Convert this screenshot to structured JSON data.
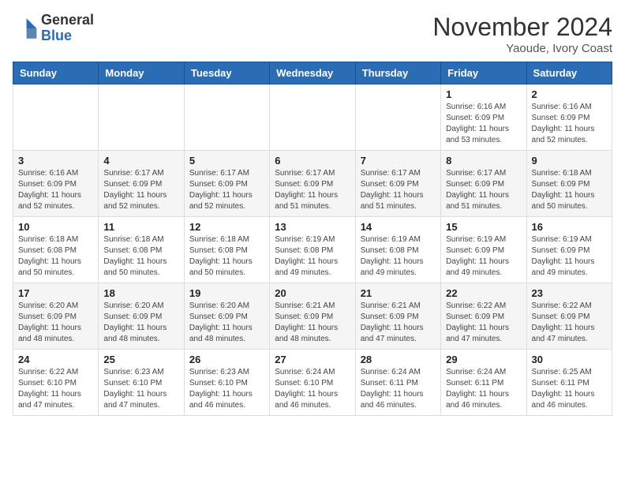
{
  "logo": {
    "general": "General",
    "blue": "Blue"
  },
  "title": "November 2024",
  "location": "Yaoude, Ivory Coast",
  "days_of_week": [
    "Sunday",
    "Monday",
    "Tuesday",
    "Wednesday",
    "Thursday",
    "Friday",
    "Saturday"
  ],
  "weeks": [
    [
      {
        "day": "",
        "detail": ""
      },
      {
        "day": "",
        "detail": ""
      },
      {
        "day": "",
        "detail": ""
      },
      {
        "day": "",
        "detail": ""
      },
      {
        "day": "",
        "detail": ""
      },
      {
        "day": "1",
        "detail": "Sunrise: 6:16 AM\nSunset: 6:09 PM\nDaylight: 11 hours and 53 minutes."
      },
      {
        "day": "2",
        "detail": "Sunrise: 6:16 AM\nSunset: 6:09 PM\nDaylight: 11 hours and 52 minutes."
      }
    ],
    [
      {
        "day": "3",
        "detail": "Sunrise: 6:16 AM\nSunset: 6:09 PM\nDaylight: 11 hours and 52 minutes."
      },
      {
        "day": "4",
        "detail": "Sunrise: 6:17 AM\nSunset: 6:09 PM\nDaylight: 11 hours and 52 minutes."
      },
      {
        "day": "5",
        "detail": "Sunrise: 6:17 AM\nSunset: 6:09 PM\nDaylight: 11 hours and 52 minutes."
      },
      {
        "day": "6",
        "detail": "Sunrise: 6:17 AM\nSunset: 6:09 PM\nDaylight: 11 hours and 51 minutes."
      },
      {
        "day": "7",
        "detail": "Sunrise: 6:17 AM\nSunset: 6:09 PM\nDaylight: 11 hours and 51 minutes."
      },
      {
        "day": "8",
        "detail": "Sunrise: 6:17 AM\nSunset: 6:09 PM\nDaylight: 11 hours and 51 minutes."
      },
      {
        "day": "9",
        "detail": "Sunrise: 6:18 AM\nSunset: 6:09 PM\nDaylight: 11 hours and 50 minutes."
      }
    ],
    [
      {
        "day": "10",
        "detail": "Sunrise: 6:18 AM\nSunset: 6:08 PM\nDaylight: 11 hours and 50 minutes."
      },
      {
        "day": "11",
        "detail": "Sunrise: 6:18 AM\nSunset: 6:08 PM\nDaylight: 11 hours and 50 minutes."
      },
      {
        "day": "12",
        "detail": "Sunrise: 6:18 AM\nSunset: 6:08 PM\nDaylight: 11 hours and 50 minutes."
      },
      {
        "day": "13",
        "detail": "Sunrise: 6:19 AM\nSunset: 6:08 PM\nDaylight: 11 hours and 49 minutes."
      },
      {
        "day": "14",
        "detail": "Sunrise: 6:19 AM\nSunset: 6:08 PM\nDaylight: 11 hours and 49 minutes."
      },
      {
        "day": "15",
        "detail": "Sunrise: 6:19 AM\nSunset: 6:09 PM\nDaylight: 11 hours and 49 minutes."
      },
      {
        "day": "16",
        "detail": "Sunrise: 6:19 AM\nSunset: 6:09 PM\nDaylight: 11 hours and 49 minutes."
      }
    ],
    [
      {
        "day": "17",
        "detail": "Sunrise: 6:20 AM\nSunset: 6:09 PM\nDaylight: 11 hours and 48 minutes."
      },
      {
        "day": "18",
        "detail": "Sunrise: 6:20 AM\nSunset: 6:09 PM\nDaylight: 11 hours and 48 minutes."
      },
      {
        "day": "19",
        "detail": "Sunrise: 6:20 AM\nSunset: 6:09 PM\nDaylight: 11 hours and 48 minutes."
      },
      {
        "day": "20",
        "detail": "Sunrise: 6:21 AM\nSunset: 6:09 PM\nDaylight: 11 hours and 48 minutes."
      },
      {
        "day": "21",
        "detail": "Sunrise: 6:21 AM\nSunset: 6:09 PM\nDaylight: 11 hours and 47 minutes."
      },
      {
        "day": "22",
        "detail": "Sunrise: 6:22 AM\nSunset: 6:09 PM\nDaylight: 11 hours and 47 minutes."
      },
      {
        "day": "23",
        "detail": "Sunrise: 6:22 AM\nSunset: 6:09 PM\nDaylight: 11 hours and 47 minutes."
      }
    ],
    [
      {
        "day": "24",
        "detail": "Sunrise: 6:22 AM\nSunset: 6:10 PM\nDaylight: 11 hours and 47 minutes."
      },
      {
        "day": "25",
        "detail": "Sunrise: 6:23 AM\nSunset: 6:10 PM\nDaylight: 11 hours and 47 minutes."
      },
      {
        "day": "26",
        "detail": "Sunrise: 6:23 AM\nSunset: 6:10 PM\nDaylight: 11 hours and 46 minutes."
      },
      {
        "day": "27",
        "detail": "Sunrise: 6:24 AM\nSunset: 6:10 PM\nDaylight: 11 hours and 46 minutes."
      },
      {
        "day": "28",
        "detail": "Sunrise: 6:24 AM\nSunset: 6:11 PM\nDaylight: 11 hours and 46 minutes."
      },
      {
        "day": "29",
        "detail": "Sunrise: 6:24 AM\nSunset: 6:11 PM\nDaylight: 11 hours and 46 minutes."
      },
      {
        "day": "30",
        "detail": "Sunrise: 6:25 AM\nSunset: 6:11 PM\nDaylight: 11 hours and 46 minutes."
      }
    ]
  ]
}
